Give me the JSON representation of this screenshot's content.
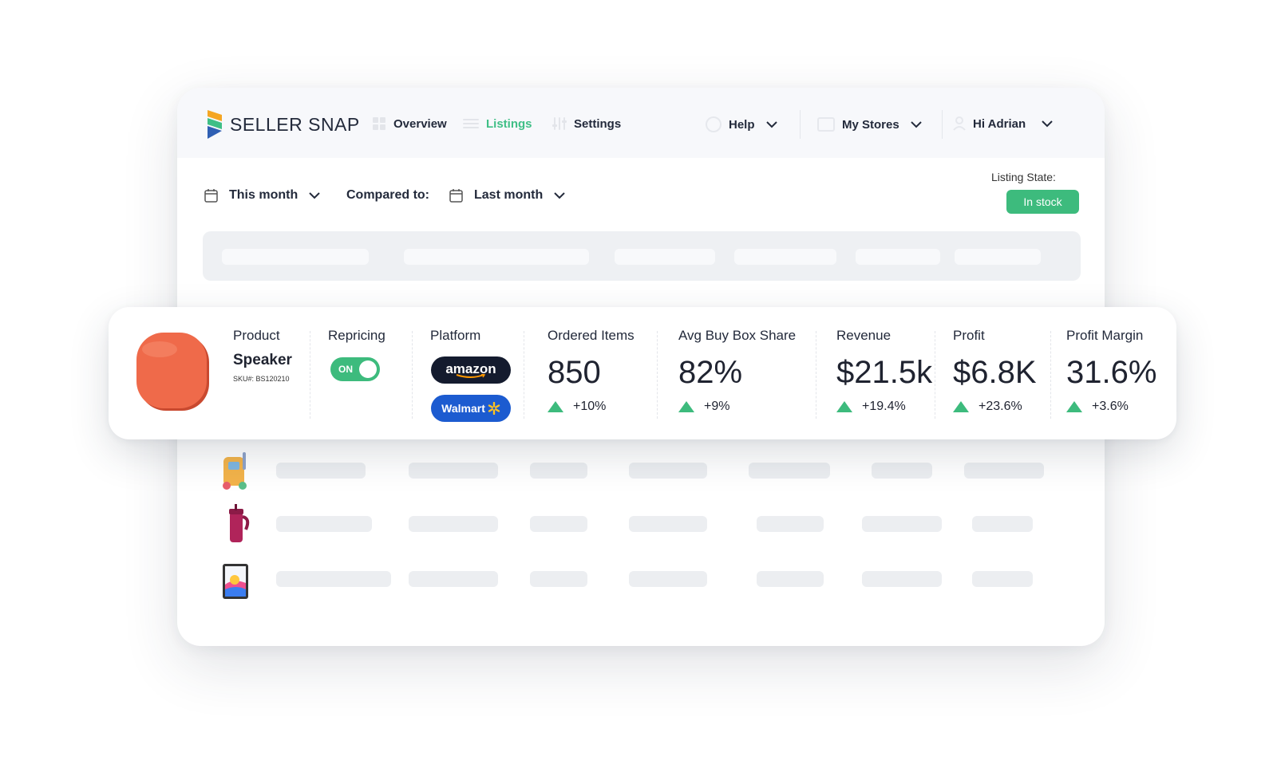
{
  "app": {
    "brand": "SELLER SNAP"
  },
  "nav": {
    "overview": "Overview",
    "listings": "Listings",
    "settings": "Settings",
    "help": "Help",
    "stores": "My Stores",
    "user": "Hi Adrian"
  },
  "filters": {
    "period": "This month",
    "compared_label": "Compared to:",
    "compare_period": "Last month"
  },
  "listing_state": {
    "label": "Listing State:",
    "value": "In stock"
  },
  "colors": {
    "accent": "#3fbf86",
    "amazon": "#141b2e",
    "walmart": "#1c5bd0",
    "speaker": "#ef6a4a"
  },
  "card": {
    "headers": {
      "product": "Product",
      "repricing": "Repricing",
      "platform": "Platform",
      "ordered": "Ordered Items",
      "buybox": "Avg Buy Box Share",
      "revenue": "Revenue",
      "profit": "Profit",
      "margin": "Profit Margin"
    },
    "product": {
      "name": "Speaker",
      "sku": "SKU#: BS120210"
    },
    "repricing": {
      "state": "ON"
    },
    "platforms": {
      "amazon": "amazon",
      "walmart": "Walmart"
    },
    "metrics": {
      "ordered": {
        "value": "850",
        "delta": "+10%"
      },
      "buybox": {
        "value": "82%",
        "delta": "+9%"
      },
      "revenue": {
        "value": "$21.5k",
        "delta": "+19.4%"
      },
      "profit": {
        "value": "$6.8K",
        "delta": "+23.6%"
      },
      "margin": {
        "value": "31.6%",
        "delta": "+3.6%"
      }
    }
  },
  "other_rows": [
    {
      "icon": "toy-icon"
    },
    {
      "icon": "tumbler-icon"
    },
    {
      "icon": "tablet-icon"
    }
  ]
}
